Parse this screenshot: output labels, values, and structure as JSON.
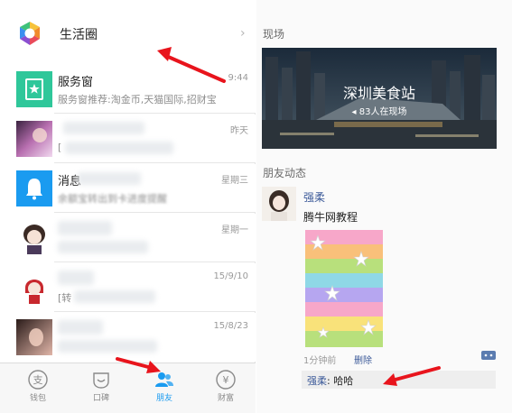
{
  "left": {
    "life_circle": {
      "label": "生活圈"
    },
    "chats": [
      {
        "title": "服务窗",
        "preview": "服务窗推荐:淘金币,天猫国际,招财宝",
        "time": "9:44"
      },
      {
        "title": "",
        "preview": "[",
        "time": "昨天"
      },
      {
        "title": "消息",
        "preview": "余额宝转出到卡进度提醒",
        "time": "星期三"
      },
      {
        "title": "",
        "preview": "",
        "time": "星期一"
      },
      {
        "title": "",
        "preview": "[转",
        "time": "15/9/10"
      },
      {
        "title": "",
        "preview": "",
        "time": "15/8/23"
      }
    ],
    "tabbar": [
      {
        "label": "钱包",
        "glyph": "支"
      },
      {
        "label": "口碑",
        "glyph": ""
      },
      {
        "label": "朋友",
        "glyph": ""
      },
      {
        "label": "财富",
        "glyph": "¥"
      }
    ]
  },
  "right": {
    "live_section": {
      "title": "现场"
    },
    "banner": {
      "title": "深圳美食站",
      "subtitle": "83人在现场"
    },
    "friends_section": {
      "title": "朋友动态"
    },
    "moment": {
      "name": "强柔",
      "text": "腾牛网教程",
      "time": "1分钟前",
      "delete_label": "删除",
      "comment_name": "强柔",
      "comment_text": ": 哈哈"
    }
  },
  "colors": {
    "accent_blue": "#1a9bf0",
    "service_green": "#2fc79a",
    "arrow_red": "#e8141c",
    "name_blue": "#3c5a99"
  }
}
